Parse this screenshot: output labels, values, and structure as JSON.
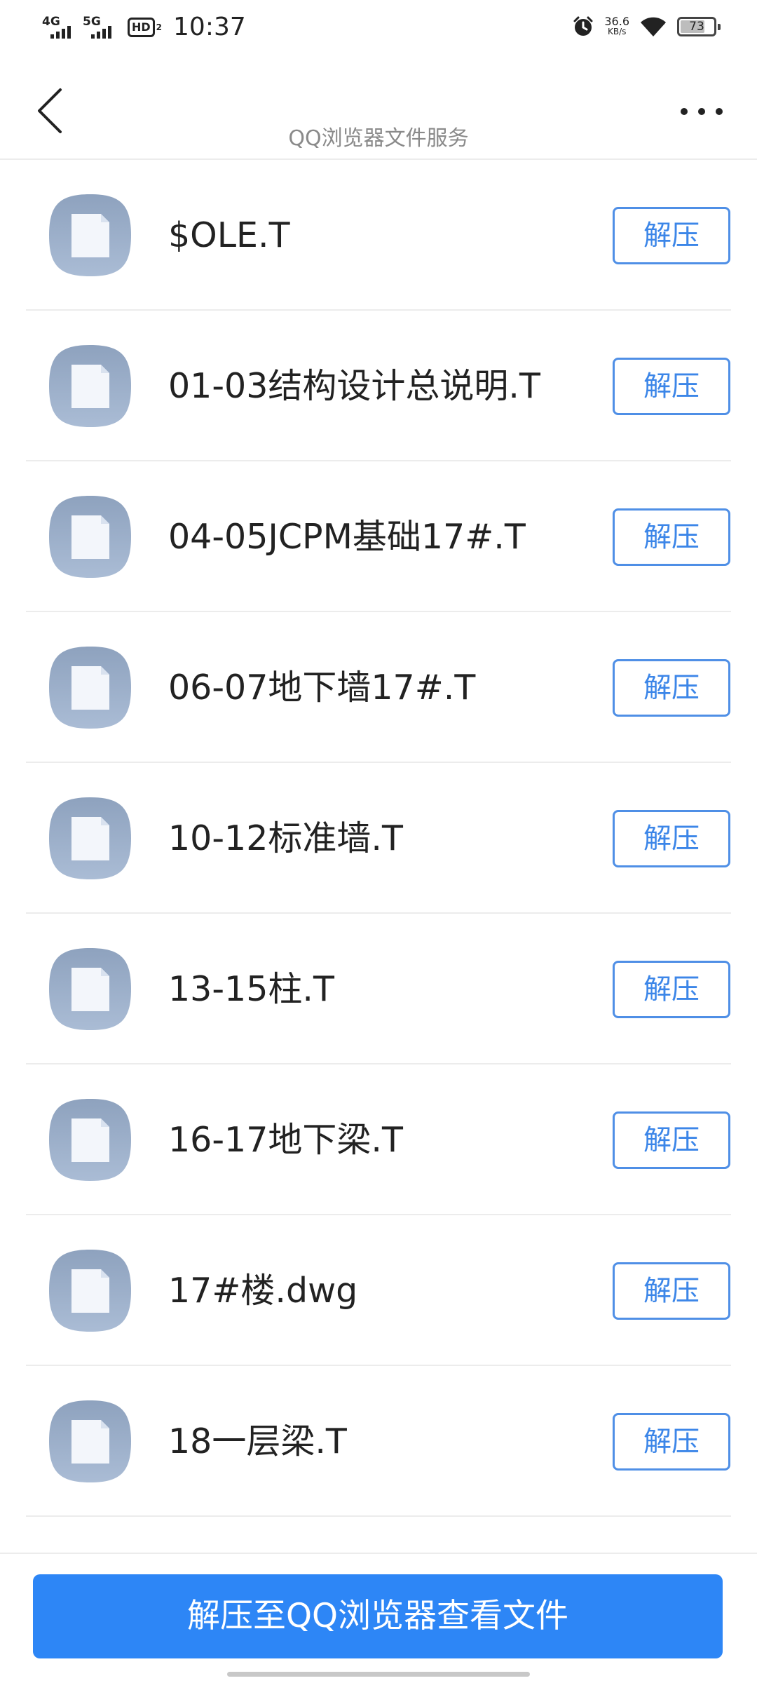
{
  "status_bar": {
    "network_1": "4G",
    "network_2": "5G",
    "hd_label": "HD",
    "hd_sub": "2",
    "time": "10:37",
    "speed_value": "36.6",
    "speed_unit": "KB/s",
    "battery": "73",
    "battery_level": 0.73
  },
  "nav": {
    "title": "QQ浏览器文件服务"
  },
  "files": [
    {
      "name": "$OLE.T",
      "action": "解压"
    },
    {
      "name": "01-03结构设计总说明.T",
      "action": "解压"
    },
    {
      "name": "04-05JCPM基础17#.T",
      "action": "解压"
    },
    {
      "name": "06-07地下墙17#.T",
      "action": "解压"
    },
    {
      "name": "10-12标准墙.T",
      "action": "解压"
    },
    {
      "name": "13-15柱.T",
      "action": "解压"
    },
    {
      "name": "16-17地下梁.T",
      "action": "解压"
    },
    {
      "name": "17#楼.dwg",
      "action": "解压"
    },
    {
      "name": "18一层梁.T",
      "action": "解压"
    }
  ],
  "bottom_button": "解压至QQ浏览器查看文件",
  "colors": {
    "accent": "#2d86f6",
    "button_border": "#4f8fe6",
    "icon_gradient_top": "#8fa3bf",
    "icon_gradient_bottom": "#a9bbd4"
  },
  "icons": {
    "back": "back-arrow-icon",
    "more": "more-dots-icon",
    "file": "file-icon",
    "alarm": "alarm-icon",
    "wifi": "wifi-icon",
    "battery": "battery-icon"
  }
}
